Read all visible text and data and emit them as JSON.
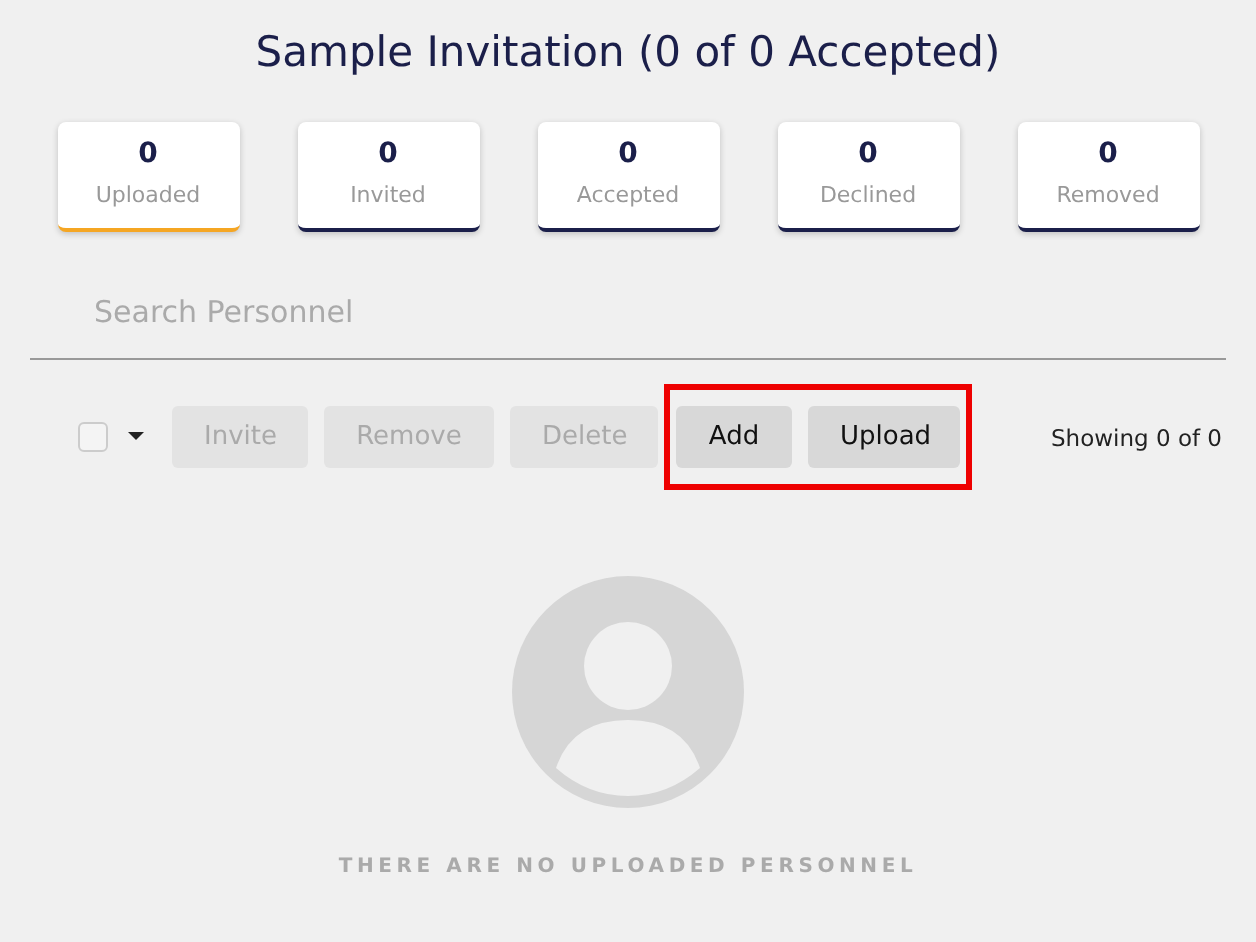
{
  "title": "Sample Invitation (0 of 0 Accepted)",
  "stats": [
    {
      "count": "0",
      "label": "Uploaded",
      "selected": true
    },
    {
      "count": "0",
      "label": "Invited",
      "selected": false
    },
    {
      "count": "0",
      "label": "Accepted",
      "selected": false
    },
    {
      "count": "0",
      "label": "Declined",
      "selected": false
    },
    {
      "count": "0",
      "label": "Removed",
      "selected": false
    }
  ],
  "search": {
    "placeholder": "Search Personnel"
  },
  "select_all": {
    "checked": false
  },
  "buttons": [
    {
      "label": "Invite",
      "disabled": true,
      "highlighted": false
    },
    {
      "label": "Remove",
      "disabled": true,
      "highlighted": false
    },
    {
      "label": "Delete",
      "disabled": true,
      "highlighted": false
    },
    {
      "label": "Add",
      "disabled": false,
      "highlighted": true
    },
    {
      "label": "Upload",
      "disabled": false,
      "highlighted": true
    }
  ],
  "showing": "Showing 0 of 0",
  "empty_message": "THERE ARE NO UPLOADED PERSONNEL"
}
